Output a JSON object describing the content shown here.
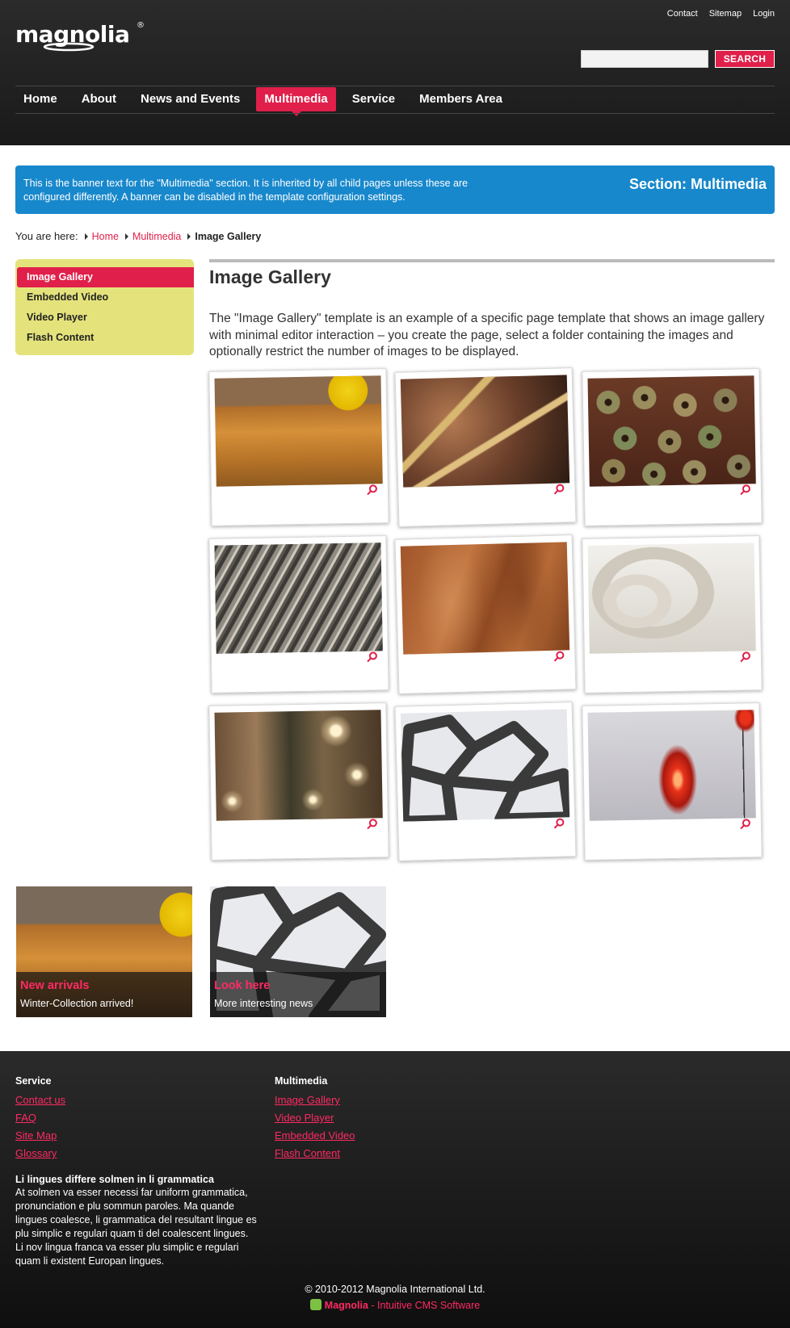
{
  "header": {
    "logo_text": "magnolia",
    "logo_reg": "®",
    "util_nav": [
      "Contact",
      "Sitemap",
      "Login"
    ],
    "search": {
      "placeholder": "",
      "button_label": "SEARCH"
    },
    "main_nav": [
      {
        "label": "Home",
        "active": false
      },
      {
        "label": "About",
        "active": false
      },
      {
        "label": "News and Events",
        "active": false
      },
      {
        "label": "Multimedia",
        "active": true
      },
      {
        "label": "Service",
        "active": false
      },
      {
        "label": "Members Area",
        "active": false
      }
    ]
  },
  "banner": {
    "text": "This is the banner text for the \"Multimedia\" section. It is inherited by all child pages unless these are configured differently. A banner can be disabled in the template configuration settings.",
    "section_label": "Section: Multimedia"
  },
  "breadcrumb": {
    "prefix": "You are here:",
    "items": [
      "Home",
      "Multimedia"
    ],
    "current": "Image Gallery"
  },
  "sidebar": {
    "items": [
      {
        "label": "Image Gallery",
        "active": true
      },
      {
        "label": "Embedded Video",
        "active": false
      },
      {
        "label": "Video Player",
        "active": false
      },
      {
        "label": "Flash Content",
        "active": false
      }
    ]
  },
  "main": {
    "title": "Image Gallery",
    "intro": "The \"Image Gallery\" template is an example of a specific page template that shows an image gallery with minimal editor interaction – you create the page, select a folder containing the images and optionally restrict the number of images to be displayed."
  },
  "gallery": {
    "images": [
      "wood-and-yellow",
      "curved-metal",
      "rusty-washers",
      "stone-texture",
      "brown-waves",
      "white-swirl",
      "blurry-lights",
      "black-lattice",
      "red-lamp"
    ],
    "zoom_icon": "zoom-icon"
  },
  "teasers": [
    {
      "title": "New arrivals",
      "text": "Winter-Collection arrived!"
    },
    {
      "title": "Look here",
      "text": "More interesting news"
    }
  ],
  "footer": {
    "col1": {
      "heading": "Service",
      "links": [
        "Contact us",
        "FAQ",
        "Site Map",
        "Glossary"
      ]
    },
    "col2": {
      "heading": "Multimedia",
      "links": [
        "Image Gallery",
        "Video Player",
        "Embedded Video",
        "Flash Content"
      ]
    },
    "about": {
      "heading": "Li lingues differe solmen in li grammatica",
      "text": "At solmen va esser necessi far uniform grammatica, pronunciation e plu sommun paroles. Ma quande lingues coalesce, li grammatica del resultant lingue es plu simplic e regulari quam ti del coalescent lingues. Li nov lingua franca va esser plu simplic e regulari quam li existent Europan lingues."
    },
    "copyright": "© 2010-2012 Magnolia International Ltd.",
    "brand_name": "Magnolia",
    "brand_tagline": " - Intuitive CMS Software"
  },
  "colors": {
    "accent": "#e01f4a",
    "banner_blue": "#1888cc",
    "sidebar_yellow": "#e4e37b",
    "header_dark": "#222222"
  }
}
